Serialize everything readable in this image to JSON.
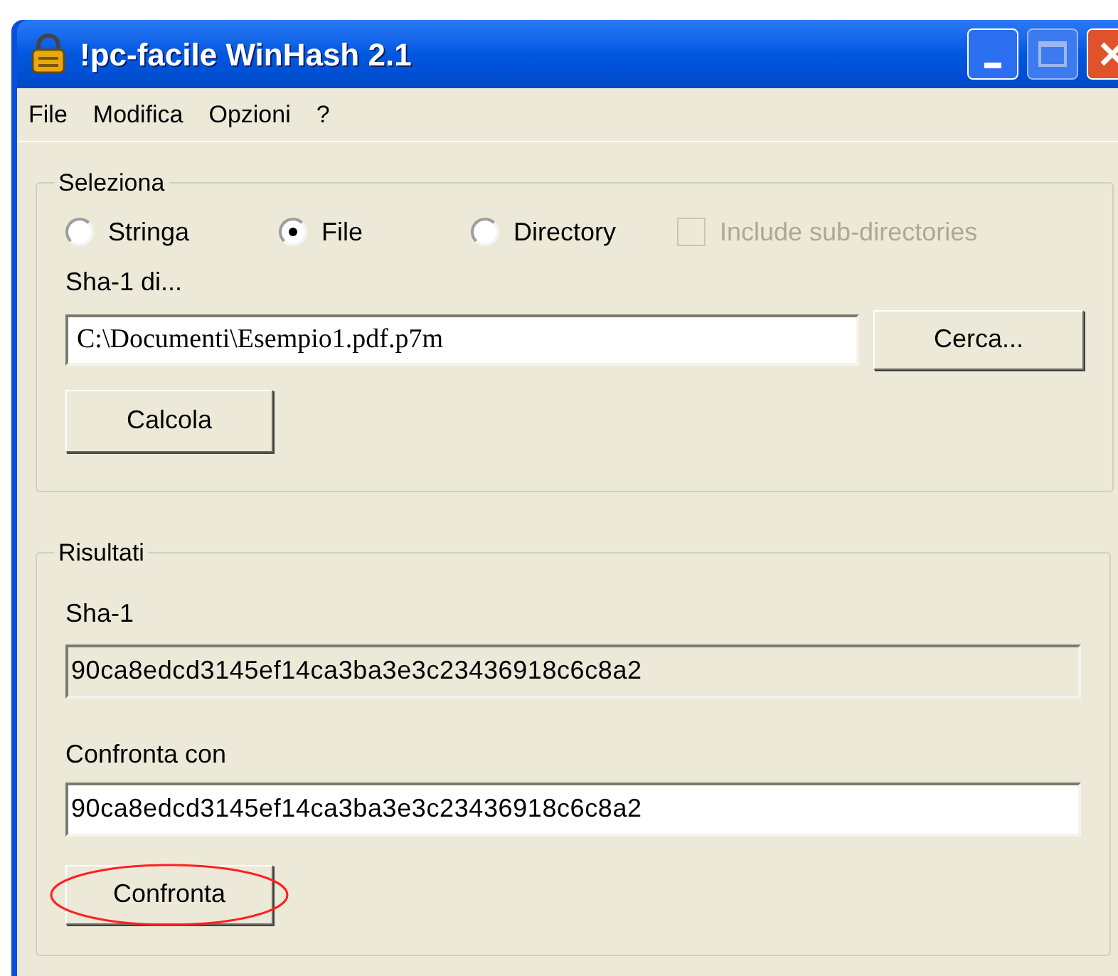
{
  "window": {
    "title": "!pc-facile WinHash 2.1"
  },
  "menu": [
    "File",
    "Modifica",
    "Opzioni",
    "?"
  ],
  "select_group": {
    "title": "Seleziona",
    "options": [
      {
        "label": "Stringa",
        "selected": false
      },
      {
        "label": "File",
        "selected": true
      },
      {
        "label": "Directory",
        "selected": false
      }
    ],
    "include_sub": {
      "label": "Include sub-directories",
      "checked": false,
      "disabled": true
    },
    "file_label": "Sha-1 di...",
    "file_value": "C:\\Documenti\\Esempio1.pdf.p7m",
    "browse_button": "Cerca...",
    "compute_button": "Calcola"
  },
  "results_group": {
    "title": "Risultati",
    "hash_label": "Sha-1",
    "hash_value": "90ca8edcd3145ef14ca3ba3e3c23436918c6c8a2",
    "compare_label": "Confronta con",
    "compare_value": "90ca8edcd3145ef14ca3ba3e3c23436918c6c8a2",
    "compare_button": "Confronta",
    "compare_button_circled": true
  }
}
